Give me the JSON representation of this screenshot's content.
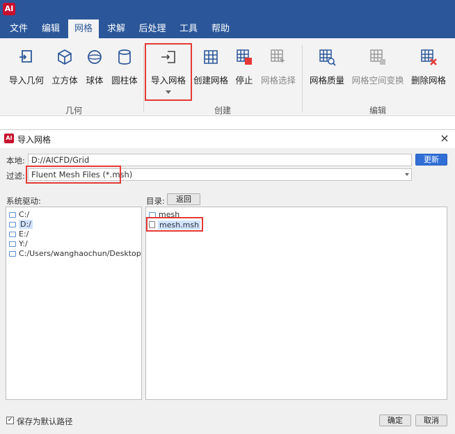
{
  "app": {
    "logo_text": "AI",
    "menu": [
      {
        "label": "文件",
        "active": false
      },
      {
        "label": "编辑",
        "active": false
      },
      {
        "label": "网格",
        "active": true
      },
      {
        "label": "求解",
        "active": false
      },
      {
        "label": "后处理",
        "active": false
      },
      {
        "label": "工具",
        "active": false
      },
      {
        "label": "帮助",
        "active": false
      }
    ],
    "ribbon": {
      "geometry_group": "几何",
      "create_group": "创建",
      "edit_group": "编辑",
      "buttons": {
        "import_geometry": "导入几何",
        "cube": "立方体",
        "sphere": "球体",
        "cylinder": "圆柱体",
        "import_mesh": "导入网格",
        "create_mesh": "创建网格",
        "stop": "停止",
        "mesh_select": "网格选择",
        "mesh_quality": "网格质量",
        "mesh_transform": "网格空间变换",
        "delete_mesh": "删除网格"
      }
    }
  },
  "dialog": {
    "title": "导入网格",
    "local_label": "本地:",
    "local_path": "D://AICFD/Grid",
    "update_button": "更新",
    "filter_label": "过滤:",
    "filter_value": "Fluent Mesh Files (*.msh)",
    "drives_label": "系统驱动:",
    "drives": [
      "C:/",
      "D:/",
      "E:/",
      "Y:/",
      "C:/Users/wanghaochun/Desktop"
    ],
    "dir_label": "目录:",
    "back_button": "返回",
    "entries": [
      {
        "name": "mesh",
        "type": "folder"
      },
      {
        "name": "mesh.msh",
        "type": "file"
      }
    ],
    "save_default_label": "保存为默认路径",
    "save_default_checked": "✓",
    "ok_button": "确定",
    "cancel_button": "取消"
  },
  "colors": {
    "accent": "#2b579a",
    "highlight": "#e53935",
    "primary_button": "#2f6fd6"
  }
}
